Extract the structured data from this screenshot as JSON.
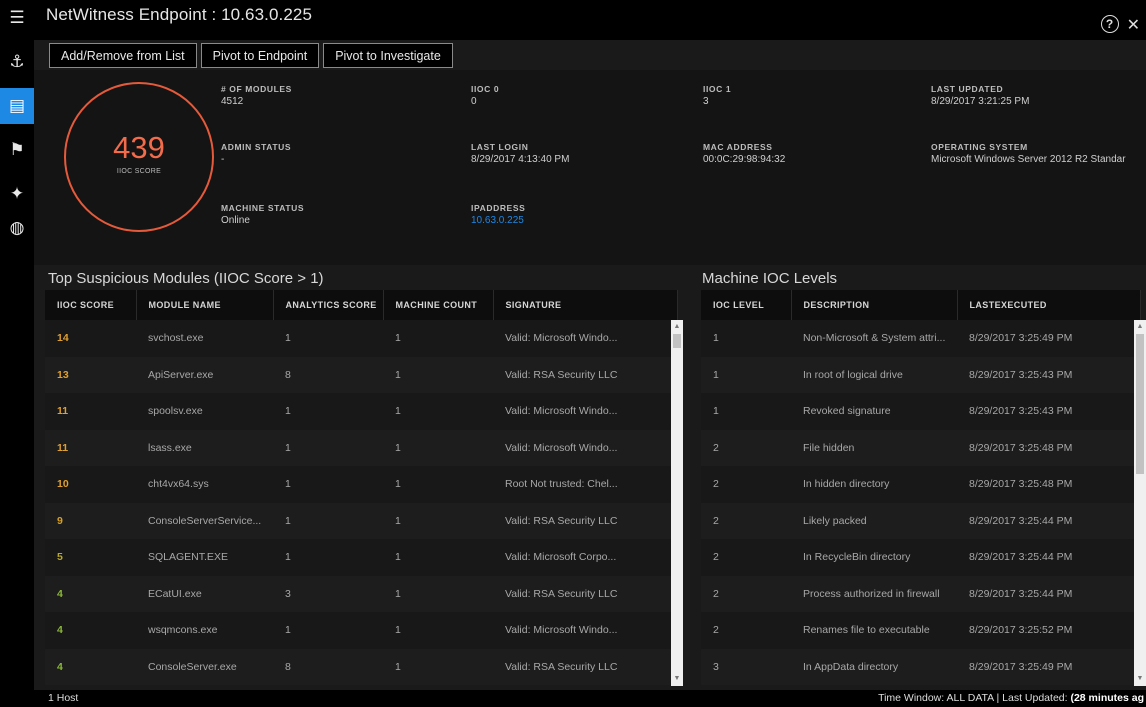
{
  "window": {
    "title": "NetWitness Endpoint : 10.63.0.225"
  },
  "sidebar": {
    "items": [
      {
        "name": "menu",
        "icon": "list-menu-icon",
        "glyph": "☰"
      },
      {
        "name": "investigate",
        "icon": "anchor-icon",
        "glyph": "⚓"
      },
      {
        "name": "hosts",
        "icon": "host-monitor-icon",
        "glyph": "▤",
        "active": true
      },
      {
        "name": "flags",
        "icon": "flag-icon",
        "glyph": "⚑"
      },
      {
        "name": "alerts",
        "icon": "alert-bell-icon",
        "glyph": "✦"
      },
      {
        "name": "network",
        "icon": "globe-icon",
        "glyph": "◍"
      }
    ]
  },
  "toolbar": {
    "add_remove_label": "Add/Remove from List",
    "pivot_endpoint_label": "Pivot to Endpoint",
    "pivot_investigate_label": "Pivot to Investigate"
  },
  "summary": {
    "iioc_score": "439",
    "iioc_score_label": "IIOC SCORE",
    "ring_color": "#e55a3a",
    "modules_label": "# OF MODULES",
    "modules_value": "4512",
    "iioc0_label": "IIOC 0",
    "iioc0_value": "0",
    "iioc1_label": "IIOC 1",
    "iioc1_value": "3",
    "last_updated_label": "LAST UPDATED",
    "last_updated_value": "8/29/2017 3:21:25 PM",
    "admin_status_label": "ADMIN STATUS",
    "admin_status_value": "-",
    "last_login_label": "LAST LOGIN",
    "last_login_value": "8/29/2017 4:13:40 PM",
    "mac_label": "MAC ADDRESS",
    "mac_value": "00:0C:29:98:94:32",
    "os_label": "OPERATING SYSTEM",
    "os_value": "Microsoft Windows Server 2012 R2 Standar",
    "machine_status_label": "MACHINE STATUS",
    "machine_status_value": "Online",
    "ip_label": "IPADDRESS",
    "ip_value": "10.63.0.225"
  },
  "modules_table": {
    "title": "Top Suspicious Modules (IIOC Score > 1)",
    "columns": [
      "IIOC SCORE",
      "MODULE NAME",
      "ANALYTICS SCORE",
      "MACHINE COUNT",
      "SIGNATURE"
    ],
    "rows": [
      {
        "score": "14",
        "color": "#e0a030",
        "name": "svchost.exe",
        "analytics": "1",
        "count": "1",
        "signature": "Valid: Microsoft Windo..."
      },
      {
        "score": "13",
        "color": "#e0a030",
        "name": "ApiServer.exe",
        "analytics": "8",
        "count": "1",
        "signature": "Valid: RSA Security LLC"
      },
      {
        "score": "11",
        "color": "#e0a030",
        "name": "spoolsv.exe",
        "analytics": "1",
        "count": "1",
        "signature": "Valid: Microsoft Windo..."
      },
      {
        "score": "11",
        "color": "#e0a030",
        "name": "lsass.exe",
        "analytics": "1",
        "count": "1",
        "signature": "Valid: Microsoft Windo..."
      },
      {
        "score": "10",
        "color": "#e0a030",
        "name": "cht4vx64.sys",
        "analytics": "1",
        "count": "1",
        "signature": "Root Not trusted: Chel..."
      },
      {
        "score": "9",
        "color": "#d4a02a",
        "name": "ConsoleServerService...",
        "analytics": "1",
        "count": "1",
        "signature": "Valid: RSA Security LLC"
      },
      {
        "score": "5",
        "color": "#b8a830",
        "name": "SQLAGENT.EXE",
        "analytics": "1",
        "count": "1",
        "signature": "Valid: Microsoft Corpo..."
      },
      {
        "score": "4",
        "color": "#8ab838",
        "name": "ECatUI.exe",
        "analytics": "3",
        "count": "1",
        "signature": "Valid: RSA Security LLC"
      },
      {
        "score": "4",
        "color": "#8ab838",
        "name": "wsqmcons.exe",
        "analytics": "1",
        "count": "1",
        "signature": "Valid: Microsoft Windo..."
      },
      {
        "score": "4",
        "color": "#8ab838",
        "name": "ConsoleServer.exe",
        "analytics": "8",
        "count": "1",
        "signature": "Valid: RSA Security LLC"
      }
    ]
  },
  "ioc_table": {
    "title": "Machine IOC Levels",
    "columns": [
      "IOC LEVEL",
      "DESCRIPTION",
      "LASTEXECUTED"
    ],
    "rows": [
      {
        "level": "1",
        "description": "Non-Microsoft & System attri...",
        "last": "8/29/2017 3:25:49 PM"
      },
      {
        "level": "1",
        "description": "In root of logical drive",
        "last": "8/29/2017 3:25:43 PM"
      },
      {
        "level": "1",
        "description": "Revoked signature",
        "last": "8/29/2017 3:25:43 PM"
      },
      {
        "level": "2",
        "description": "File hidden",
        "last": "8/29/2017 3:25:48 PM"
      },
      {
        "level": "2",
        "description": "In hidden directory",
        "last": "8/29/2017 3:25:48 PM"
      },
      {
        "level": "2",
        "description": "Likely packed",
        "last": "8/29/2017 3:25:44 PM"
      },
      {
        "level": "2",
        "description": "In RecycleBin directory",
        "last": "8/29/2017 3:25:44 PM"
      },
      {
        "level": "2",
        "description": "Process authorized in firewall",
        "last": "8/29/2017 3:25:44 PM"
      },
      {
        "level": "2",
        "description": "Renames file to executable",
        "last": "8/29/2017 3:25:52 PM"
      },
      {
        "level": "3",
        "description": "In AppData directory",
        "last": "8/29/2017 3:25:49 PM"
      }
    ]
  },
  "footer": {
    "hosts": "1 Host",
    "status_prefix": "Time Window: ALL DATA | Last Updated: ",
    "status_bold": "(28 minutes ag"
  }
}
